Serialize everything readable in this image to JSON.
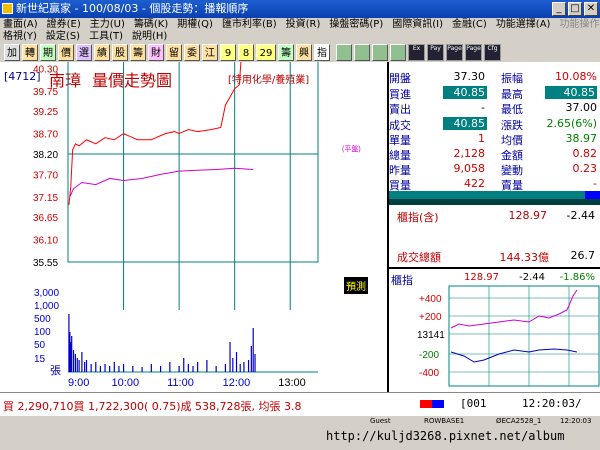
{
  "title": "新世紀贏家 - 100/08/03 - 個股走勢：播報順序",
  "menu": {
    "row1": [
      "畫面(A)",
      "證券(E)",
      "主力(U)",
      "籌碼(K)",
      "期權(Q)",
      "匯市利率(B)",
      "投資(R)",
      "操盤密碼(P)",
      "國際資訊(I)",
      "金融(C)",
      "功能選擇(A)"
    ],
    "row1_disabled": "功能操作",
    "row2": [
      "格視(Y)",
      "設定(S)",
      "工具(T)",
      "說明(H)"
    ]
  },
  "toolbar": {
    "chars": [
      "加",
      "轉",
      "期",
      "價",
      "選",
      "績",
      "股",
      "籌",
      "財",
      "留",
      "委",
      "江"
    ],
    "nums": [
      "9",
      "8",
      "29"
    ],
    "tail": [
      "籌",
      "興",
      "指"
    ],
    "icons": [
      "Ex",
      "Pay",
      "Page",
      "Page",
      "Cfg"
    ]
  },
  "stock": {
    "code": "[4712]",
    "name": "南璋",
    "view": "量價走勢圖",
    "industry": "[特用化學/養殖業]"
  },
  "price_axis": [
    "40.85",
    "40.30",
    "39.75",
    "39.25",
    "38.70",
    "38.20",
    "37.70",
    "37.15",
    "36.65",
    "36.10",
    "35.55"
  ],
  "ref_price": "38.20",
  "ref_tag": "(平盤)",
  "vol_axis": [
    "3,000",
    "1,000",
    "500",
    "100",
    "50",
    "15"
  ],
  "vol_unit": "張",
  "time_axis": [
    "9:00",
    "10:00",
    "11:00",
    "12:00",
    "13:00"
  ],
  "predict_label": "預測",
  "quote": {
    "open_label": "開盤",
    "open": "37.30",
    "amp_label": "振幅",
    "amp": "10.08%",
    "bid_label": "買進",
    "bid": "40.85",
    "high_label": "最高",
    "high": "40.85",
    "ask_label": "賣出",
    "ask": "-",
    "low_label": "最低",
    "low": "37.00",
    "trade_label": "成交",
    "trade": "40.85",
    "chg_label": "漲跌",
    "chg": "2.65(6%)",
    "unit_label": "單量",
    "unit": "1",
    "avg_label": "均價",
    "avg": "38.97",
    "tvol_label": "總量",
    "tvol": "2,128",
    "amt_label": "金額",
    "amt": "0.82",
    "yvol_label": "昨量",
    "yvol": "9,058",
    "turn_label": "變動",
    "turn": "0.23",
    "bvol_label": "買量",
    "bvol": "422",
    "svol_label": "賣量",
    "svol": "-"
  },
  "index": {
    "label": "櫃指(含)",
    "value": "128.97",
    "change": "-2.44",
    "total_label": "成交總額",
    "total": "144.33億",
    "total_chg": "26.7"
  },
  "mini": {
    "label": "櫃指",
    "value": "128.97",
    "change": "-2.44",
    "pct": "-1.86%",
    "axis": [
      "+400",
      "+200",
      "13141",
      "-200",
      "-400"
    ]
  },
  "status": {
    "text": "買 2,290,710買 1,722,300( 0.75)成 538,728張, 均張 3.8",
    "code": "[001",
    "time": "12:20:03/"
  },
  "bottom": {
    "items": [
      "Guest",
      "ROWBASE1",
      "ØECA2528_1",
      "12:20:03"
    ],
    "url": "http://kuljd3268.pixnet.net/album"
  },
  "colors": {
    "up": "#d00000",
    "down": "#008000",
    "avg": "#d000d0",
    "vol": "#0000c8",
    "price": "#ff0000",
    "grid": "#008080"
  }
}
